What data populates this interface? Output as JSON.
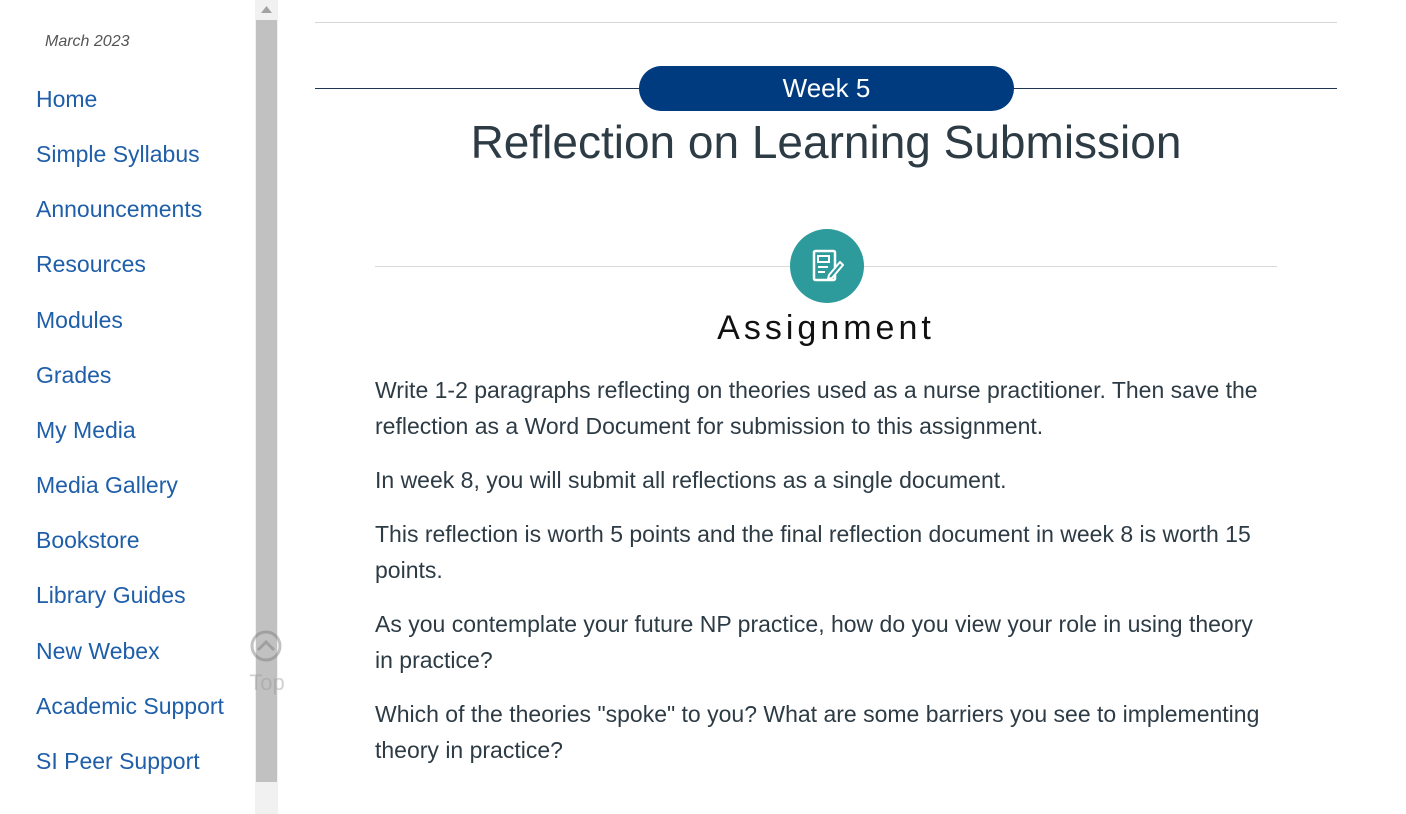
{
  "sidebar": {
    "term": "March 2023",
    "items": [
      {
        "label": "Home"
      },
      {
        "label": "Simple Syllabus"
      },
      {
        "label": "Announcements"
      },
      {
        "label": "Resources"
      },
      {
        "label": "Modules"
      },
      {
        "label": "Grades"
      },
      {
        "label": "My Media"
      },
      {
        "label": "Media Gallery"
      },
      {
        "label": "Bookstore"
      },
      {
        "label": "Library Guides"
      },
      {
        "label": "New Webex"
      },
      {
        "label": "Academic Support"
      },
      {
        "label": "SI Peer Support"
      }
    ],
    "top_button_label": "Top"
  },
  "main": {
    "week_label": "Week 5",
    "title": "Reflection on Learning Submission",
    "section_heading": "Assignment",
    "section_icon": "assignment-edit-icon",
    "paragraphs": [
      "Write 1-2 paragraphs reflecting on theories used as a nurse practitioner. Then save the reflection as a Word Document for submission to this assignment.",
      "In week 8, you will submit all reflections as a single document.",
      "This reflection is worth 5 points and the final reflection document in week 8 is worth 15 points.",
      "As you contemplate your future NP practice, how do you view your role in using theory in practice?",
      "Which of the theories \"spoke\" to you? What are some barriers you see to implementing theory in practice?"
    ]
  },
  "colors": {
    "link": "#1f5ea8",
    "week_pill": "#003b80",
    "icon_circle": "#2d9b9b",
    "text": "#2d3b45"
  }
}
